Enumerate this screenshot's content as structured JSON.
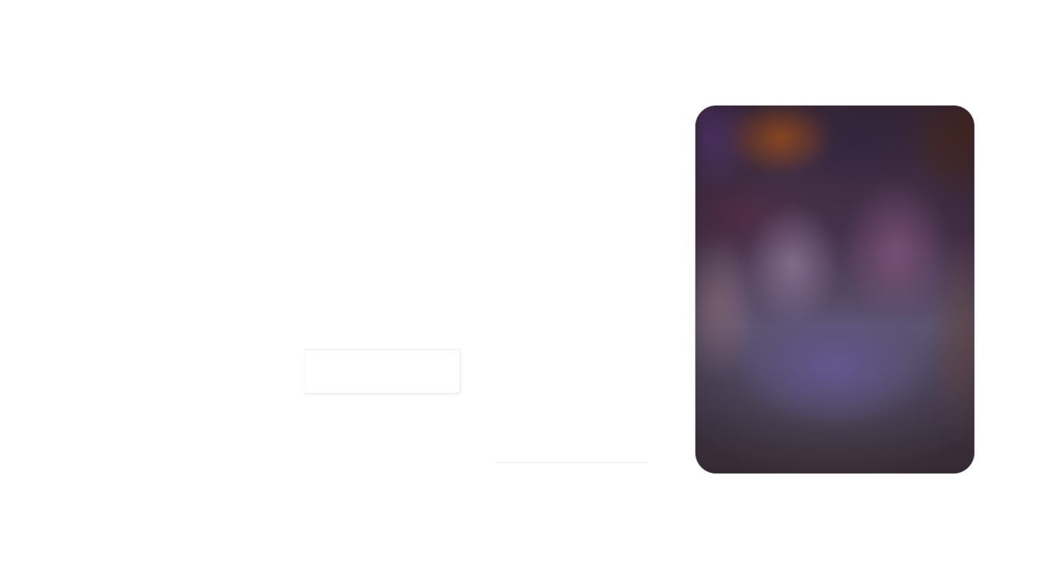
{
  "button": {
    "label": ""
  },
  "hero_image": {
    "alt": "",
    "dominant_colors": [
      "#3b2a3c",
      "#8a6070",
      "#5d5472",
      "#a0501e",
      "#40353d"
    ]
  }
}
